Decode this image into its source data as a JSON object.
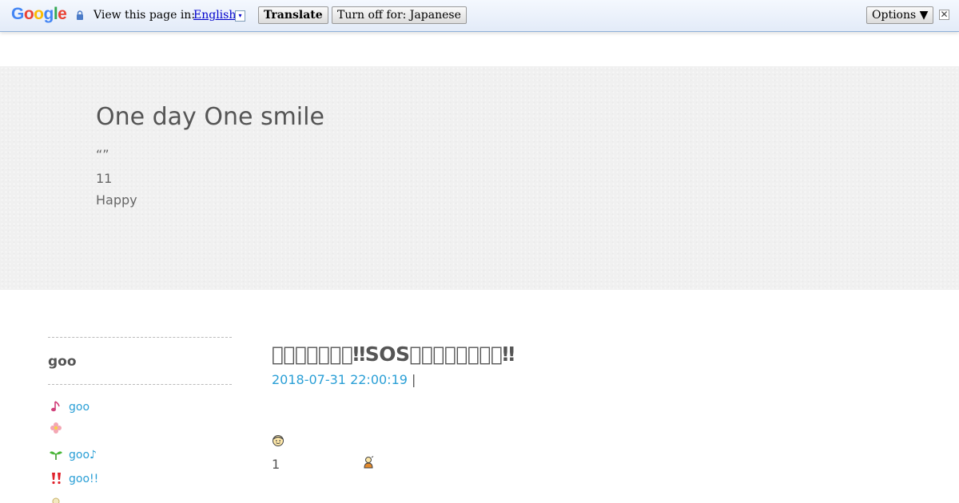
{
  "translate_bar": {
    "logo": {
      "g1": "G",
      "o1": "o",
      "o2": "o",
      "g2": "g",
      "l": "l",
      "e": "e"
    },
    "prompt": "View this page in:",
    "language": "English",
    "dropdown_glyph": "▾",
    "translate_button": "Translate",
    "turn_off_button": "Turn off for: Japanese",
    "options_button": "Options ▼",
    "close_glyph": "✕"
  },
  "header": {
    "title": "One day One smile",
    "desc_line1": "“”",
    "desc_line2": "11",
    "desc_line3": "Happy"
  },
  "sidebar": {
    "title": "goo",
    "items": [
      {
        "icon": "music-note-icon",
        "label": "goo"
      },
      {
        "icon": "flower-icon",
        "label": ""
      },
      {
        "icon": "sprout-icon",
        "label": "goo♪"
      },
      {
        "icon": "double-exclamation-icon",
        "label": "goo!!"
      }
    ]
  },
  "post": {
    "title": "􀀀􀀀􀀀􀀀􀀀􀀀􀀀‼SOS􀀀􀀀􀀀􀀀􀀀􀀀􀀀􀀀‼",
    "date": "2018-07-31 22:00:19",
    "separator": "|",
    "number": "1"
  },
  "colors": {
    "link": "#2a9fd6",
    "text": "#555555",
    "hero_bg": "#f0f0f0"
  }
}
